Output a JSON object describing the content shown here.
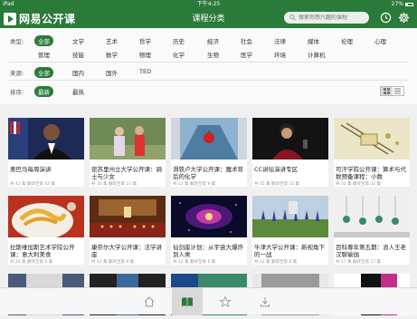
{
  "status": {
    "device": "iPad",
    "time": "下午4:25",
    "battery": "27%",
    "battery_level": 0.27
  },
  "nav": {
    "app_name": "网易公开课",
    "title": "课程分类",
    "search_placeholder": "搜索你感兴趣的课程"
  },
  "filters": {
    "category_label": "类型:",
    "category_row1": [
      "全部",
      "文学",
      "艺术",
      "哲学",
      "历史",
      "经济",
      "社会",
      "法律",
      "媒体",
      "伦理",
      "心理"
    ],
    "category_row2": [
      "管理",
      "技能",
      "数学",
      "物理",
      "化学",
      "生物",
      "医学",
      "环境",
      "计算机"
    ],
    "source_label": "来源:",
    "sources": [
      "全部",
      "国内",
      "国外",
      "TED"
    ],
    "sort_label": "排序:",
    "sorts": [
      "最新",
      "最热"
    ]
  },
  "courses": [
    {
      "title": "奥巴马每周演讲",
      "meta": "共 43 集  翻译至第 43 集"
    },
    {
      "title": "密苏里州立大学公开课：骑士与少女",
      "meta": "共 30 集  翻译至第 23 集"
    },
    {
      "title": "滑铁卢大学公开课：魔术背后的化学",
      "meta": "共 12 集  翻译至第 9 集"
    },
    {
      "title": "CC讲坛演讲专区",
      "meta": "共 15 集  翻译至第 15 集"
    },
    {
      "title": "可汗学院公开课：算术与代数预备课程：小数",
      "meta": "共 32 集  翻译至第 32 集"
    },
    {
      "title": "拉斯维加斯艺术学院公开课：意大利美食",
      "meta": "共 24 集  翻译至第 6 集"
    },
    {
      "title": "康奈尔大学公开课：法学讲座",
      "meta": "共 13 集  翻译至第 9 集"
    },
    {
      "title": "仙剑座计划：从宇宙大爆炸到人类",
      "meta": "共 12 集  翻译至第 6 集"
    },
    {
      "title": "牛津大学公开课：新视角下的一战",
      "meta": "共 12 集  翻译至第 8 集"
    },
    {
      "title": "百科尊年第五期：浪人王老汉聊瑜伽",
      "meta": "共 17 集  翻译至第 17 集"
    }
  ],
  "colors": {
    "brand": "#2a7a3a"
  },
  "tabs": [
    "home-icon",
    "book-icon",
    "star-icon",
    "download-icon"
  ]
}
